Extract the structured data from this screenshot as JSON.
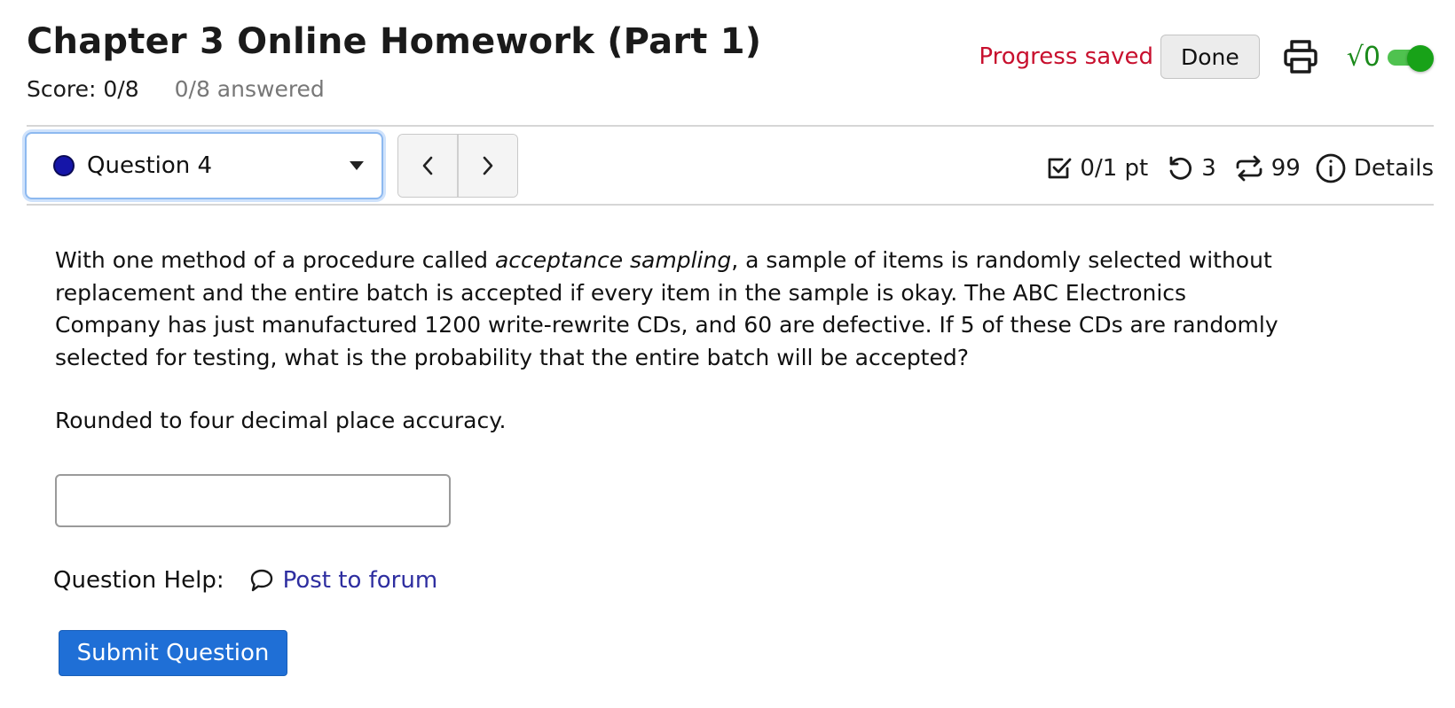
{
  "header": {
    "title": "Chapter 3 Online Homework (Part 1)",
    "score": "Score: 0/8",
    "answered": "0/8 answered",
    "progress_status": "Progress saved",
    "done_label": "Done",
    "math_toggle_glyph": "√0",
    "math_toggle_on": true
  },
  "question_nav": {
    "selected_question": "Question 4",
    "status_color": "#1515a8",
    "points": "0/1 pt",
    "retries": "3",
    "submissions": "99",
    "details_label": "Details"
  },
  "question": {
    "text_before": "With one method of a procedure called ",
    "emphasis": "acceptance sampling",
    "text_after": ", a sample of items is randomly selected without replacement and the entire batch is accepted if every item in the sample is okay. The ABC Electronics Company has just manufactured 1200 write-rewrite CDs, and 60 are defective. If 5 of these CDs are randomly selected for testing, what is the probability that the entire batch will be accepted?",
    "instruction": "Rounded to four decimal place accuracy.",
    "answer_value": ""
  },
  "help": {
    "label": "Question Help:",
    "forum_link": "Post to forum"
  },
  "submit_label": "Submit Question",
  "icons": {
    "print": "printer-icon",
    "prev": "chevron-left-icon",
    "next": "chevron-right-icon",
    "points": "checkbox-icon",
    "retries": "undo-icon",
    "submissions": "repeat-icon",
    "details": "info-icon",
    "forum": "speech-bubble-icon"
  },
  "colors": {
    "progress_saved": "#c8102e",
    "math_toggle": "#18a218",
    "submit_button": "#1f6fd6",
    "link": "#2e2ea0"
  }
}
